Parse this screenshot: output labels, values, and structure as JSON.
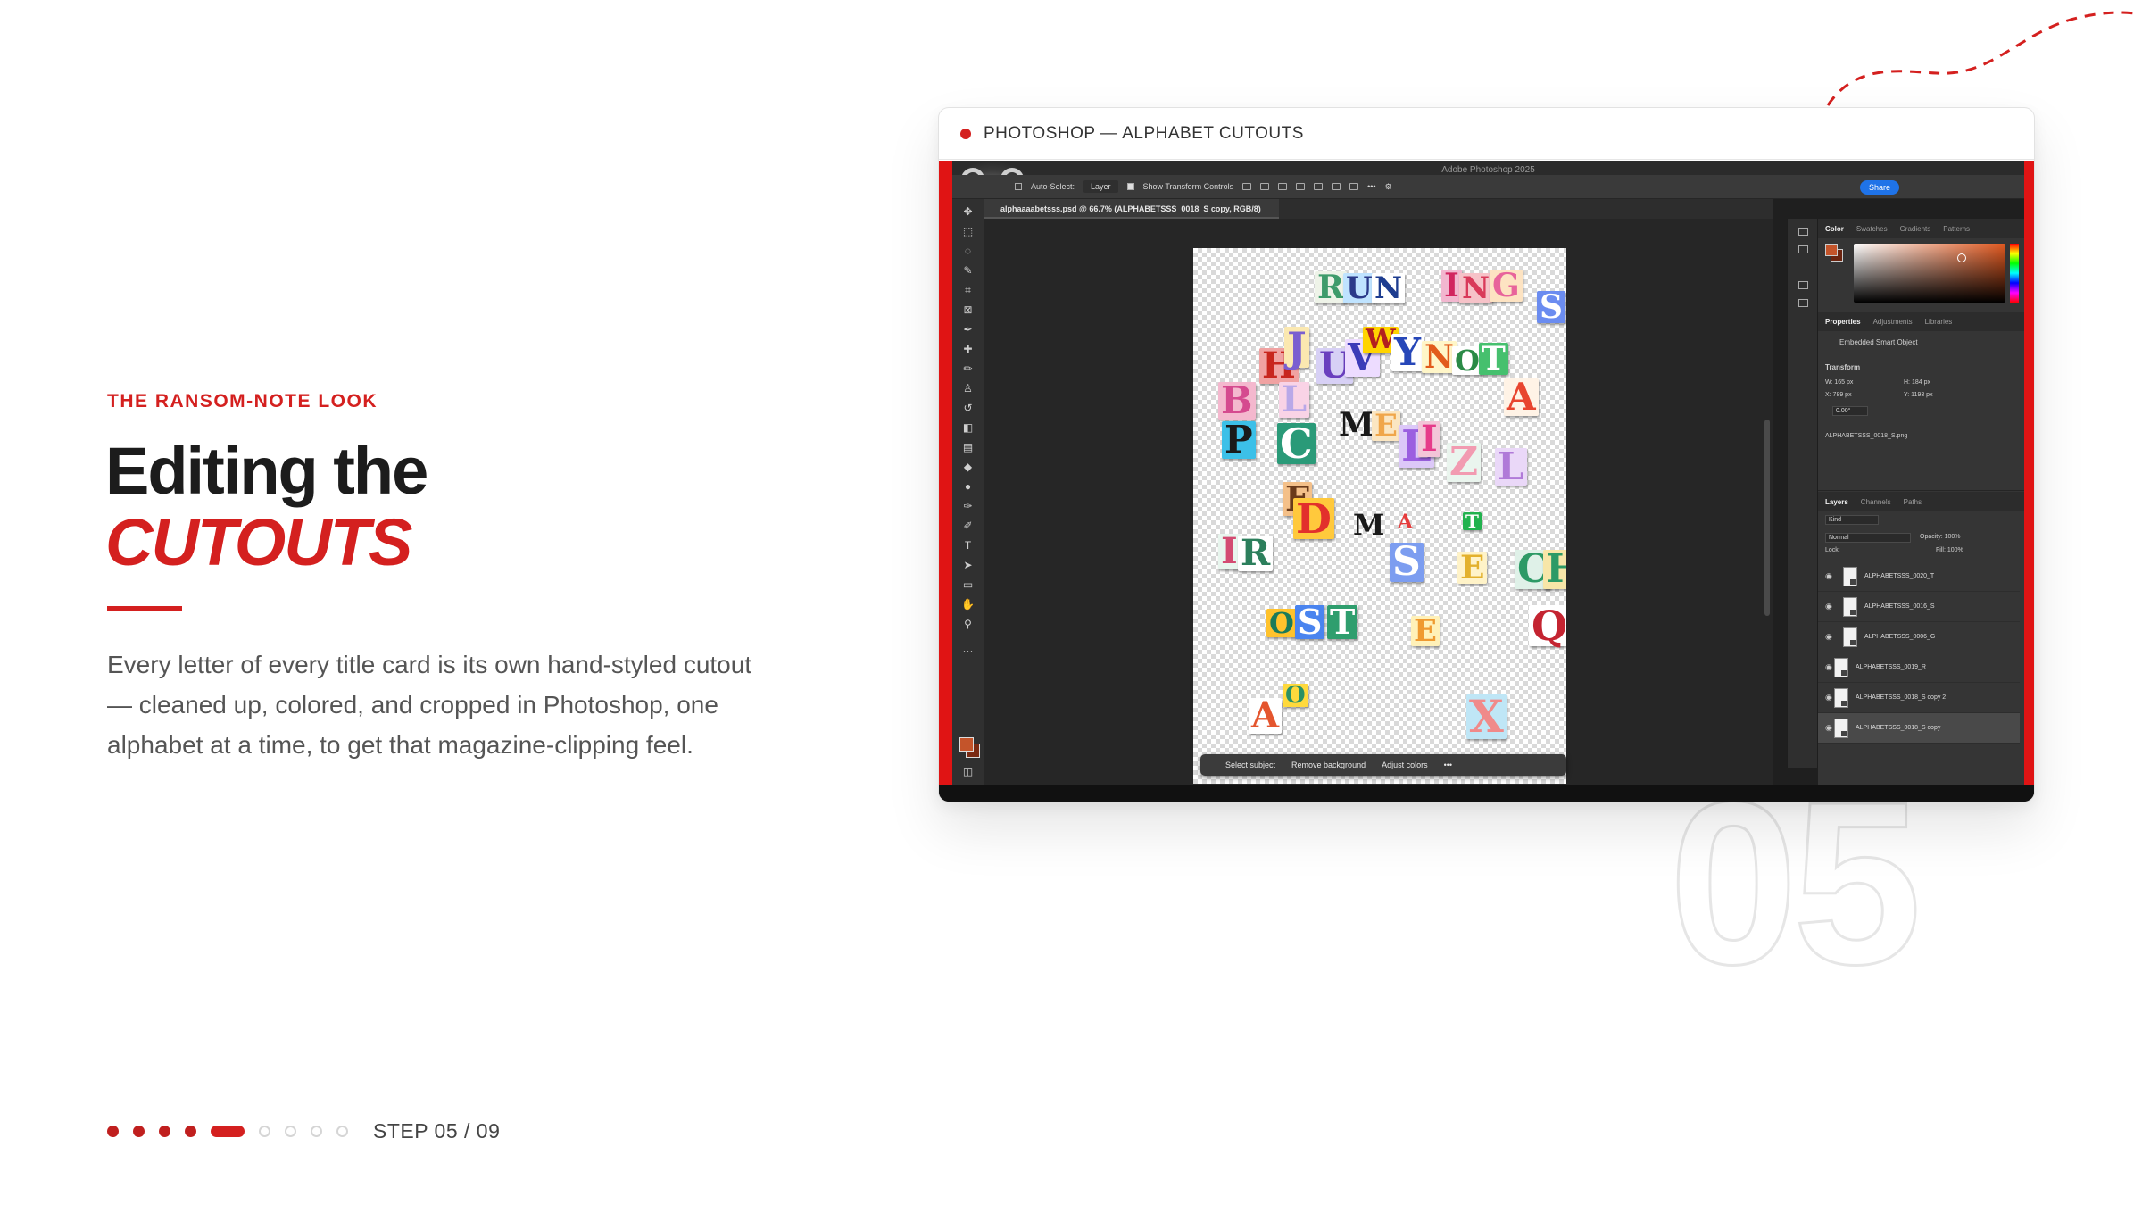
{
  "eyebrow": "THE RANSOM-NOTE LOOK",
  "headline": {
    "line1": "Editing the",
    "line2": "CUTOUTS"
  },
  "body": "Every letter of every title card is its own hand-styled cutout — cleaned up, colored, and cropped in Photoshop, one alphabet at a time, to get that magazine-clipping feel.",
  "step_number": "05",
  "progress": {
    "label": "STEP 05 / 09",
    "current": 5,
    "total": 9
  },
  "colors": {
    "accent": "#d4201f",
    "accent_dark": "#c01f1e"
  },
  "window": {
    "title": "PHOTOSHOP — ALPHABET CUTOUTS",
    "photoshop": {
      "app_title": "Adobe Photoshop 2025",
      "options_bar": {
        "auto_select": "Auto-Select:",
        "layer_select": "Layer",
        "transform_controls": "Show Transform Controls",
        "share": "Share"
      },
      "doc_tab": "alphaaaabetsss.psd @ 66.7% (ALPHABETSSS_0018_S copy, RGB/8)",
      "contextual_bar": {
        "select_subject": "Select subject",
        "remove_background": "Remove background",
        "adjust_colors": "Adjust colors"
      },
      "color_tabs": [
        "Color",
        "Swatches",
        "Gradients",
        "Patterns"
      ],
      "properties_tabs": [
        "Properties",
        "Adjustments",
        "Libraries"
      ],
      "properties": {
        "object_type": "Embedded Smart Object",
        "transform": "Transform",
        "w": "W: 165 px",
        "h": "H: 184 px",
        "x": "X: 789 px",
        "y": "Y: 1193 px",
        "angle": "0.00°",
        "filename": "ALPHABETSSS_0018_S.png"
      },
      "layers_tabs": [
        "Layers",
        "Channels",
        "Paths"
      ],
      "layers_filter": "Kind",
      "blend_mode": "Normal",
      "opacity": "Opacity: 100%",
      "lock_label": "Lock:",
      "fill": "Fill: 100%",
      "layers": [
        "ALPHABETSSS_0020_T",
        "ALPHABETSSS_0016_S",
        "ALPHABETSSS_0006_G",
        "ALPHABETSSS_0019_R",
        "ALPHABETSSS_0018_S copy 2",
        "ALPHABETSSS_0018_S copy"
      ]
    }
  }
}
